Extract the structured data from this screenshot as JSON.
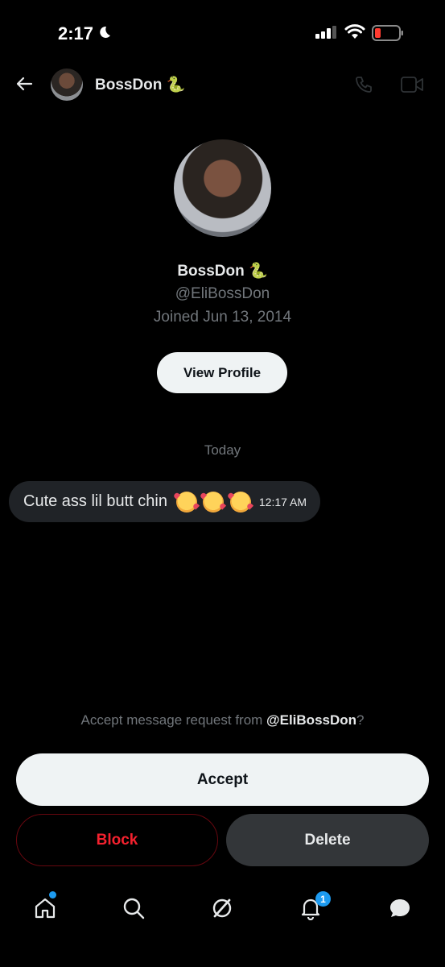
{
  "status_bar": {
    "time": "2:17"
  },
  "header": {
    "name": "BossDon 🐍"
  },
  "profile": {
    "name": "BossDon 🐍",
    "handle": "@EliBossDon",
    "joined": "Joined Jun 13, 2014",
    "view_profile_label": "View Profile"
  },
  "conversation": {
    "date_label": "Today",
    "message": {
      "text": "Cute ass lil butt chin",
      "time": "12:17 AM"
    }
  },
  "request": {
    "prompt_prefix": "Accept message request from ",
    "prompt_handle": "@EliBossDon",
    "prompt_suffix": "?",
    "accept_label": "Accept",
    "block_label": "Block",
    "delete_label": "Delete"
  },
  "nav": {
    "notifications_badge": "1"
  },
  "colors": {
    "accent": "#1d9bf0",
    "danger": "#f4212e",
    "background": "#000000"
  }
}
